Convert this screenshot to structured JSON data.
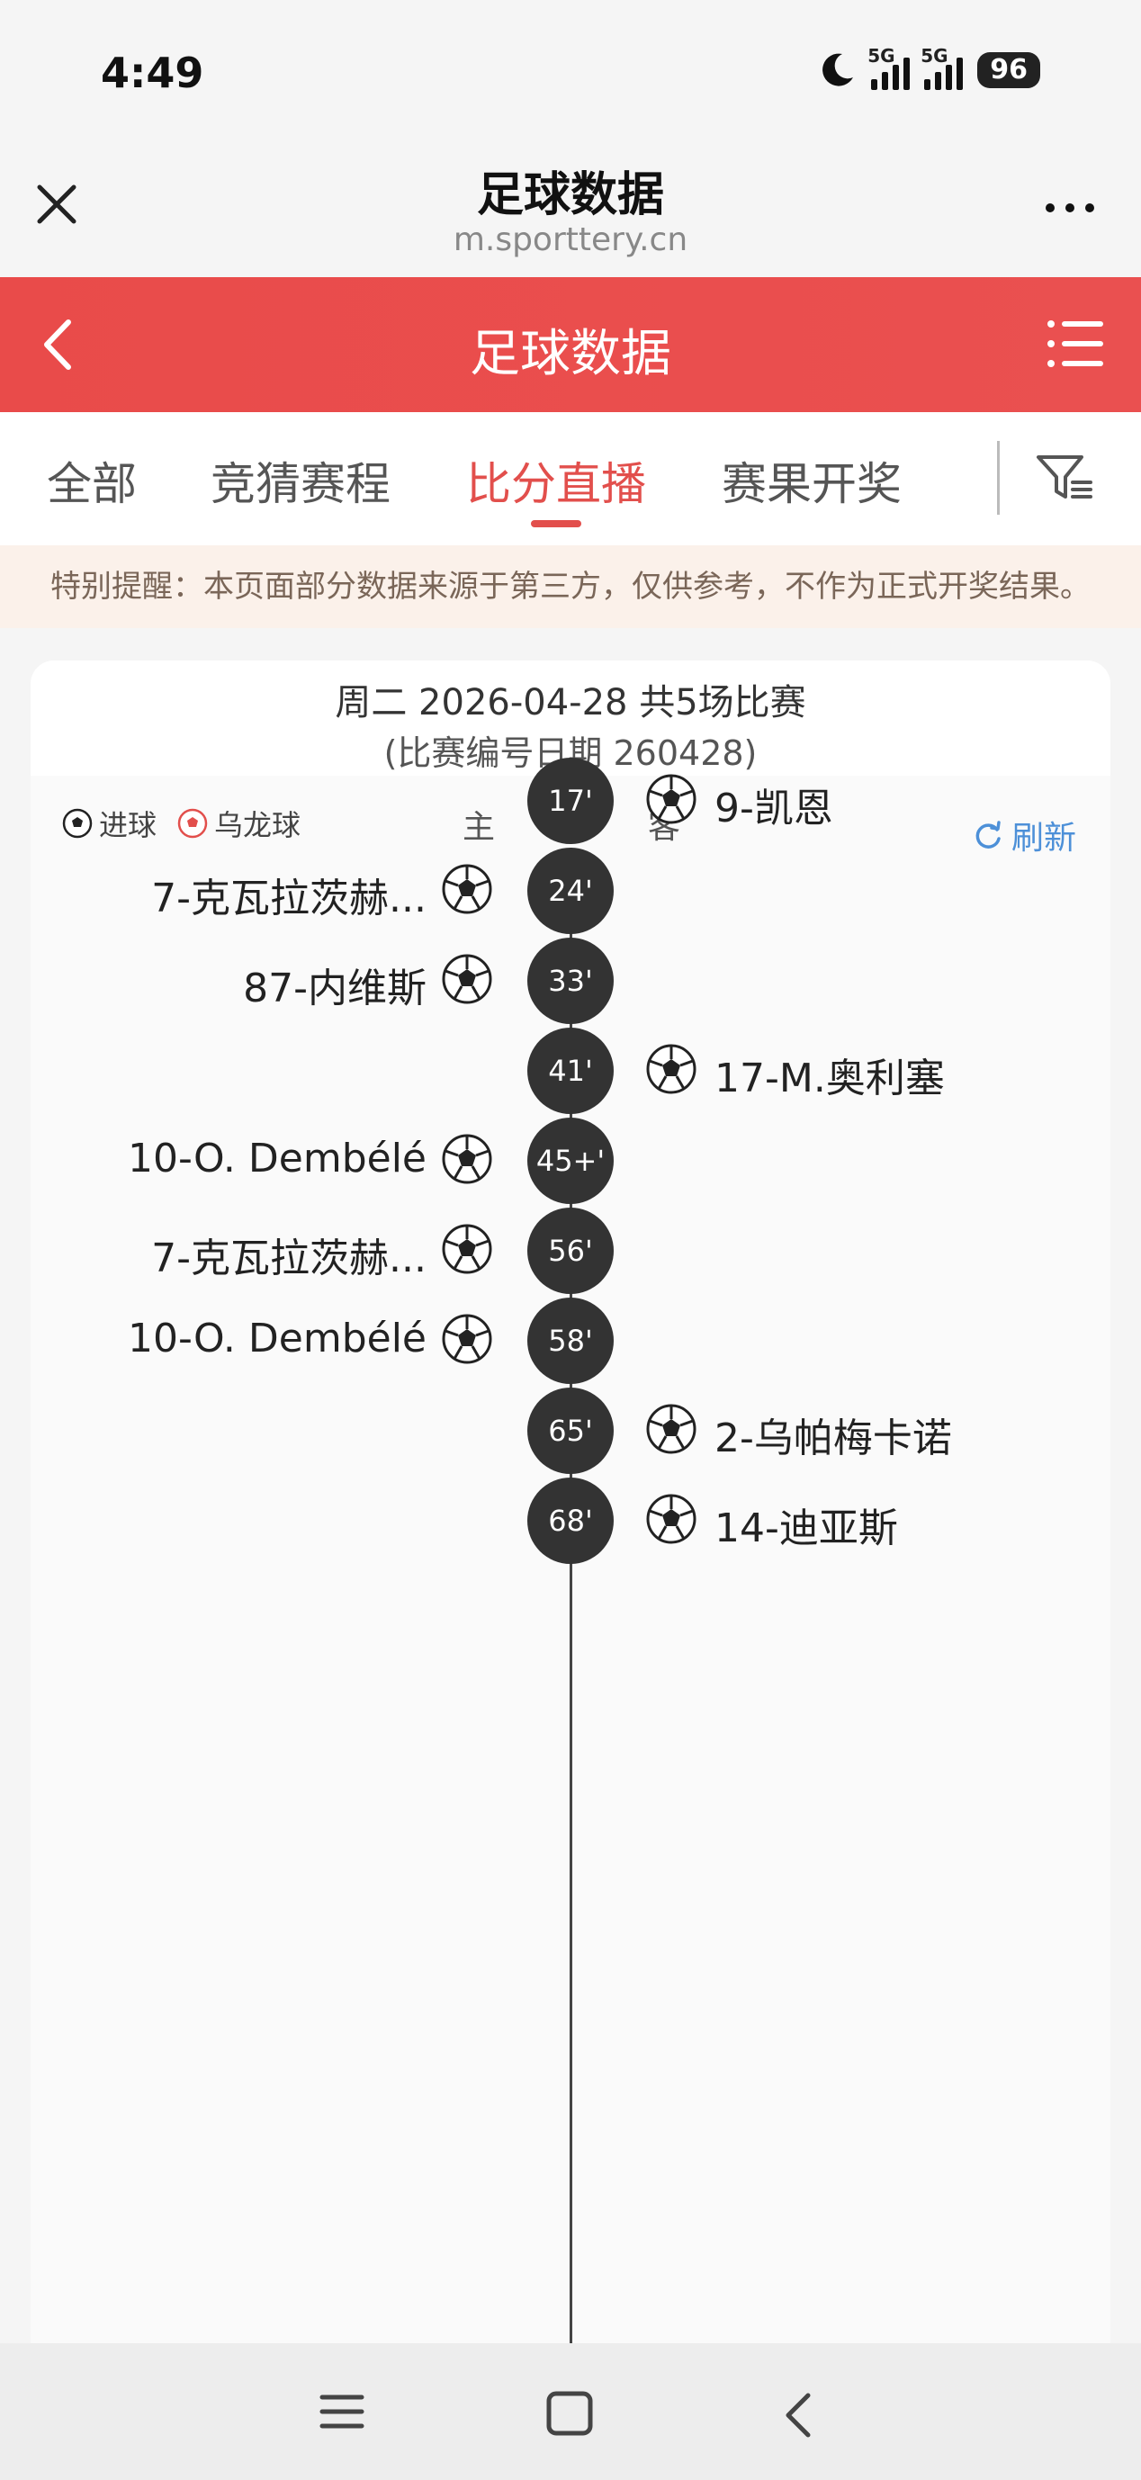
{
  "status": {
    "time": "4:49",
    "battery": "96",
    "network_labels": [
      "5G",
      "5G"
    ]
  },
  "browser": {
    "title": "足球数据",
    "url": "m.sporttery.cn"
  },
  "header": {
    "title": "足球数据"
  },
  "tabs": [
    {
      "label": "全部",
      "active": false
    },
    {
      "label": "竞猜赛程",
      "active": false
    },
    {
      "label": "比分直播",
      "active": true
    },
    {
      "label": "赛果开奖",
      "active": false
    }
  ],
  "notice": "特别提醒：本页面部分数据来源于第三方，仅供参考，不作为正式开奖结果。",
  "match": {
    "date_line": "周二 2026-04-28 共5场比赛",
    "code_line": "(比赛编号日期 260428)",
    "legend": {
      "goal": "进球",
      "own_goal": "乌龙球"
    },
    "home_label": "主",
    "away_label": "客",
    "refresh_label": "刷新",
    "accent_color": "#e24f4c",
    "events": [
      {
        "minute": "17'",
        "side": "away",
        "player": "9-凯恩"
      },
      {
        "minute": "24'",
        "side": "home",
        "player": "7-克瓦拉茨赫..."
      },
      {
        "minute": "33'",
        "side": "home",
        "player": "87-内维斯"
      },
      {
        "minute": "41'",
        "side": "away",
        "player": "17-M.奥利塞"
      },
      {
        "minute": "45+'",
        "side": "home",
        "player": "10-O. Dembélé"
      },
      {
        "minute": "56'",
        "side": "home",
        "player": "7-克瓦拉茨赫..."
      },
      {
        "minute": "58'",
        "side": "home",
        "player": "10-O. Dembélé"
      },
      {
        "minute": "65'",
        "side": "away",
        "player": "2-乌帕梅卡诺"
      },
      {
        "minute": "68'",
        "side": "away",
        "player": "14-迪亚斯"
      }
    ]
  }
}
